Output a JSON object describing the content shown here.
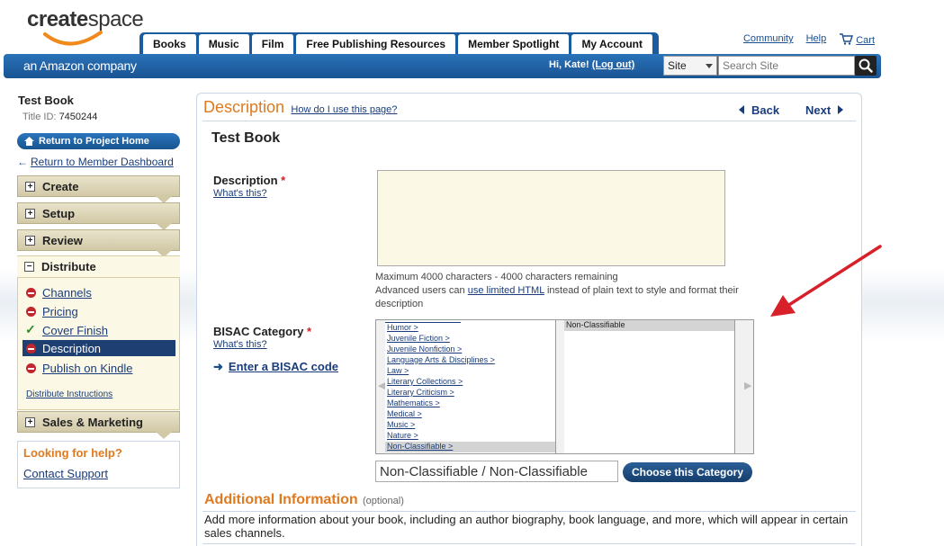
{
  "header": {
    "logo_text_bold": "create",
    "logo_text": "space",
    "tagline": "an Amazon company",
    "tabs": [
      "Books",
      "Music",
      "Film",
      "Free Publishing Resources",
      "Member Spotlight",
      "My Account"
    ],
    "util_links": {
      "community": "Community",
      "help": "Help",
      "cart": "Cart"
    },
    "greeting": "Hi, Kate!",
    "logout": "(Log out)",
    "search": {
      "scope": "Site",
      "placeholder": "Search Site"
    }
  },
  "sidebar": {
    "title": "Test Book",
    "title_id_label": "Title ID:",
    "title_id": "7450244",
    "return_project": "Return to Project Home",
    "return_dashboard": "Return to Member Dashboard",
    "sections": {
      "create": "Create",
      "setup": "Setup",
      "review": "Review",
      "distribute": "Distribute",
      "sales": "Sales & Marketing"
    },
    "distribute_items": [
      {
        "label": "Channels",
        "status": "incomplete"
      },
      {
        "label": "Pricing",
        "status": "incomplete"
      },
      {
        "label": "Cover Finish",
        "status": "complete"
      },
      {
        "label": "Description",
        "status": "current"
      },
      {
        "label": "Publish on Kindle",
        "status": "incomplete"
      }
    ],
    "distribute_instructions": "Distribute Instructions",
    "help_title": "Looking for help?",
    "help_link": "Contact Support"
  },
  "main": {
    "page_title": "Description",
    "how_link": "How do I use this page?",
    "back": "Back",
    "next": "Next",
    "book_title": "Test Book",
    "description_label": "Description",
    "required_mark": "*",
    "whats_this": "What's this?",
    "description_value": "",
    "notes": {
      "line1": "Maximum 4000 characters - 4000 characters remaining",
      "line2_pre": "Advanced users can ",
      "line2_link": "use limited HTML",
      "line2_post": " instead of plain text to style and format their description"
    },
    "bisac_label": "BISAC Category",
    "enter_code": "Enter a BISAC code",
    "bisac_categories": [
      "Humor >",
      "Juvenile Fiction >",
      "Juvenile Nonfiction >",
      "Language Arts & Disciplines >",
      "Law >",
      "Literary Collections >",
      "Literary Criticism >",
      "Mathematics >",
      "Medical >",
      "Music >",
      "Nature >",
      "Non-Classifiable >"
    ],
    "bisac_selected_sub": "Non-Classifiable",
    "chosen_category": "Non-Classifiable / Non-Classifiable",
    "choose_button": "Choose this Category",
    "additional_title": "Additional Information",
    "additional_optional": "(optional)",
    "additional_desc": "Add more information about your book, including an author biography, book language, and more, which will appear in certain sales channels."
  },
  "colors": {
    "accent_orange": "#e07a20",
    "brand_blue": "#1a5c9e",
    "annotation_red": "#d8202a"
  }
}
